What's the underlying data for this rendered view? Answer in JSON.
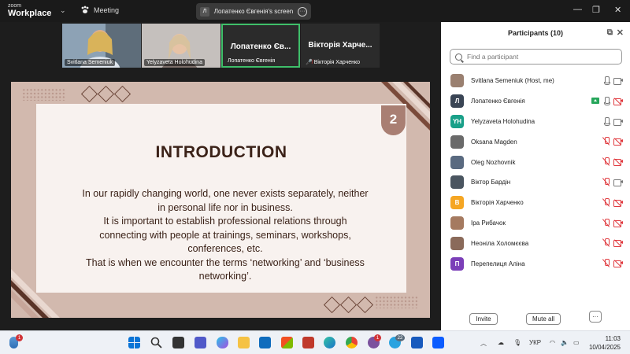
{
  "titlebar": {
    "brand_top": "zoom",
    "brand_bottom": "Workplace",
    "meeting_label": "Meeting",
    "share_initial": "Л",
    "share_text": "Лопатенко Євгенія's screen"
  },
  "video_strip": [
    {
      "name": "Svitlana Semeniuk",
      "big": "",
      "active": false
    },
    {
      "name": "Yelyzaveta Holohudina",
      "big": "",
      "active": false
    },
    {
      "name": "Лопатенко Євгенія",
      "big": "Лопатенко Єв...",
      "active": true
    },
    {
      "name": "Вікторія Харченко",
      "big": "Вікторія Харче...",
      "active": false
    }
  ],
  "slide": {
    "title": "INTRODUCTION",
    "number": "2",
    "lines": [
      "In our rapidly changing world, one never exists separately, neither",
      "in personal life nor in business.",
      "It is important to establish professional relations through",
      "connecting with people at trainings, seminars, workshops,",
      "conferences, etc.",
      "That is when we encounter the terms ‘networking’ and ‘business",
      "networking’."
    ]
  },
  "panel": {
    "title": "Participants (10)",
    "search_placeholder": "Find a participant",
    "invite_label": "Invite",
    "mute_all_label": "Mute all",
    "more_label": "···",
    "participants": [
      {
        "name": "Svitlana Semeniuk (Host, me)",
        "initials": "",
        "avatar_color": "#9a8070",
        "mic": "on",
        "cam": "on",
        "sharing": false
      },
      {
        "name": "Лопатенко Євгенія",
        "initials": "Л",
        "avatar_color": "#3a4555",
        "mic": "on",
        "cam": "off",
        "sharing": true
      },
      {
        "name": "Yelyzaveta Holohudina",
        "initials": "YH",
        "avatar_color": "#1aa089",
        "mic": "on",
        "cam": "on",
        "sharing": false
      },
      {
        "name": "Oksana Magden",
        "initials": "",
        "avatar_color": "#6a6a6a",
        "mic": "off",
        "cam": "off",
        "sharing": false
      },
      {
        "name": "Oleg Nozhovnik",
        "initials": "",
        "avatar_color": "#5a6a80",
        "mic": "off",
        "cam": "off",
        "sharing": false
      },
      {
        "name": "Віктор Бардін",
        "initials": "",
        "avatar_color": "#4a5560",
        "mic": "off",
        "cam": "on",
        "sharing": false
      },
      {
        "name": "Вікторія Харченко",
        "initials": "В",
        "avatar_color": "#f5a623",
        "mic": "off",
        "cam": "off",
        "sharing": false
      },
      {
        "name": "Іра Рибачок",
        "initials": "",
        "avatar_color": "#a57a60",
        "mic": "off",
        "cam": "off",
        "sharing": false
      },
      {
        "name": "Неоніла Холомєєва",
        "initials": "",
        "avatar_color": "#8a6a5a",
        "mic": "off",
        "cam": "off",
        "sharing": false
      },
      {
        "name": "Перепелиця Аліна",
        "initials": "П",
        "avatar_color": "#7b3fb8",
        "mic": "off",
        "cam": "off",
        "sharing": false
      }
    ]
  },
  "taskbar": {
    "language": "УКР",
    "time": "11:03",
    "date": "10/04/2025",
    "badges": [
      "1",
      "1",
      "22"
    ]
  }
}
